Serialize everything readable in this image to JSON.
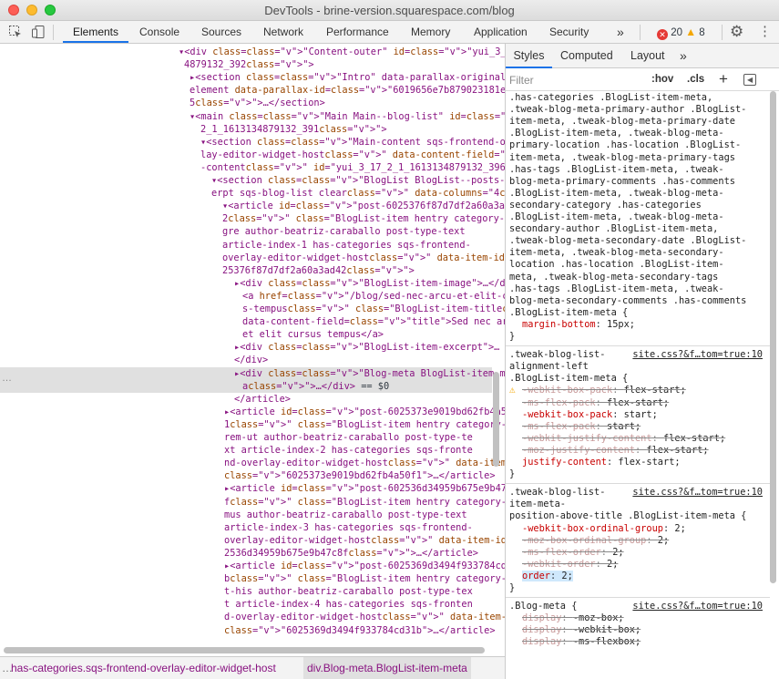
{
  "window": {
    "title": "DevTools - brine-version.squarespace.com/blog"
  },
  "toolbar": {
    "tabs": [
      {
        "label": "Elements"
      },
      {
        "label": "Console"
      },
      {
        "label": "Sources"
      },
      {
        "label": "Network"
      },
      {
        "label": "Performance"
      },
      {
        "label": "Memory"
      },
      {
        "label": "Application"
      },
      {
        "label": "Security"
      }
    ],
    "more": "»",
    "errors": "20",
    "warnings": "8"
  },
  "styles_tabs": [
    {
      "label": "Styles"
    },
    {
      "label": "Computed"
    },
    {
      "label": "Layout"
    }
  ],
  "styles_more": "»",
  "filter": {
    "placeholder": "Filter",
    "hov": ":hov",
    "cls": ".cls",
    "add": "+"
  },
  "dom_lines": [
    "▾<div class=\"Content-outer\" id=\"yui_3_17_2_1_161313",
    "4879132_392\">",
    "▸<section class=\"Intro\" data-parallax-original-",
    "element data-parallax-id=\"6019656e7b879023181ed1e",
    "5\">…</section>",
    "▾<main class=\"Main Main--blog-list\" id=\"yui_3_17_",
    "2_1_1613134879132_391\">",
    "▾<section class=\"Main-content sqs-frontend-over",
    "lay-editor-widget-host\" data-content-field=\"main",
    "-content\" id=\"yui_3_17_2_1_1613134879132_396\">",
    "▾<section class=\"BlogList BlogList--posts-exc",
    "erpt sqs-blog-list clear\" data-columns=\"4\">",
    "▾<article id=\"post-6025376f87d7df2a60a3ad4",
    "2\" class=\"BlogList-item hentry category-inte",
    "gre author-beatriz-caraballo post-type-text",
    "article-index-1 has-categories sqs-frontend-",
    "overlay-editor-widget-host\" data-item-id=\"60",
    "25376f87d7df2a60a3ad42\">",
    "▸<div class=\"BlogList-item-image\">…</div>",
    "<a href=\"/blog/sed-nec-arcu-et-elit-cursu",
    "s-tempus\" class=\"BlogList-item-title\"",
    "data-content-field=\"title\">Sed nec arcu",
    "et elit cursus tempus</a>",
    "▸<div class=\"BlogList-item-excerpt\">…",
    "</div>",
    "▸<div class=\"Blog-meta BlogList-item-met",
    "a\">…</div> == $0",
    "</article>",
    "▸<article id=\"post-6025373e9019bd62fb4a50f",
    "1\" class=\"BlogList-item hentry category-dolo",
    "rem-ut author-beatriz-caraballo post-type-te",
    "xt article-index-2 has-categories sqs-fronte",
    "nd-overlay-editor-widget-host\" data-item-id=",
    "\"6025373e9019bd62fb4a50f1\">…</article>",
    "▸<article id=\"post-602536d34959b675e9b47c8",
    "f\" class=\"BlogList-item hentry category-maxi",
    "mus author-beatriz-caraballo post-type-text",
    "article-index-3 has-categories sqs-frontend-",
    "overlay-editor-widget-host\" data-item-id=\"60",
    "2536d34959b675e9b47c8f\">…</article>",
    "▸<article id=\"post-6025369d3494f933784cd31",
    "b\" class=\"BlogList-item hentry category-dica",
    "t-his author-beatriz-caraballo post-type-tex",
    "t article-index-4 has-categories sqs-fronten",
    "d-overlay-editor-widget-host\" data-item-id=",
    "\"6025369d3494f933784cd31b\">…</article>"
  ],
  "dom_selected_ellipsis": "…",
  "breadcrumb": [
    {
      "label": "has-categories.sqs-frontend-overlay-editor-widget-host"
    },
    {
      "label": "div.Blog-meta.BlogList-item-meta"
    }
  ],
  "breadcrumb_more": "…",
  "rule1": {
    "selector_lines": [
      ".has-categories .BlogList-item-meta,",
      ".tweak-blog-meta-primary-author .BlogList-",
      "item-meta, .tweak-blog-meta-primary-date",
      ".BlogList-item-meta, .tweak-blog-meta-",
      "primary-location .has-location .BlogList-",
      "item-meta, .tweak-blog-meta-primary-tags",
      ".has-tags .BlogList-item-meta, .tweak-",
      "blog-meta-primary-comments .has-comments",
      ".BlogList-item-meta, .tweak-blog-meta-",
      "secondary-category .has-categories",
      ".BlogList-item-meta, .tweak-blog-meta-",
      "secondary-author .BlogList-item-meta,",
      ".tweak-blog-meta-secondary-date .BlogList-",
      "item-meta, .tweak-blog-meta-secondary-",
      "location .has-location .BlogList-item-",
      "meta, .tweak-blog-meta-secondary-tags",
      ".has-tags .BlogList-item-meta, .tweak-",
      "blog-meta-secondary-comments .has-comments",
      ".BlogList-item-meta {"
    ],
    "decls": [
      {
        "name": "margin-bottom",
        "value": "15px;"
      }
    ],
    "close": "}"
  },
  "rule2": {
    "selector_lines": [
      ".tweak-blog-list-",
      "alignment-left",
      ".BlogList-item-meta {"
    ],
    "source": "site.css?&f…tom=true:10",
    "decls": [
      {
        "name": "-webkit-box-pack",
        "value": "flex-start;"
      },
      {
        "name": "-ms-flex-pack",
        "value": "flex-start;"
      },
      {
        "name": "-webkit-box-pack",
        "value": "start;"
      },
      {
        "name": "-ms-flex-pack",
        "value": "start;"
      },
      {
        "name": "-webkit-justify-content",
        "value": "flex-start;"
      },
      {
        "name": "-moz-justify-content",
        "value": "flex-start;"
      },
      {
        "name": "justify-content",
        "value": "flex-start;"
      }
    ],
    "close": "}"
  },
  "rule3": {
    "selector_lines": [
      ".tweak-blog-list-",
      "item-meta-",
      "position-above-title .BlogList-item-meta {"
    ],
    "source": "site.css?&f…tom=true:10",
    "decls": [
      {
        "name": "-webkit-box-ordinal-group",
        "value": "2;"
      },
      {
        "name": "-moz-box-ordinal-group",
        "value": "2;"
      },
      {
        "name": "-ms-flex-order",
        "value": "2;"
      },
      {
        "name": "-webkit-order",
        "value": "2;"
      },
      {
        "name": "order",
        "value": "2;"
      }
    ],
    "close": "}"
  },
  "rule4": {
    "selector_lines": [
      ".Blog-meta {"
    ],
    "source": "site.css?&f…tom=true:10",
    "decls": [
      {
        "name": "display",
        "value": "-moz-box;"
      },
      {
        "name": "display",
        "value": "-webkit-box;"
      },
      {
        "name": "display",
        "value": "-ms-flexbox;"
      }
    ]
  }
}
